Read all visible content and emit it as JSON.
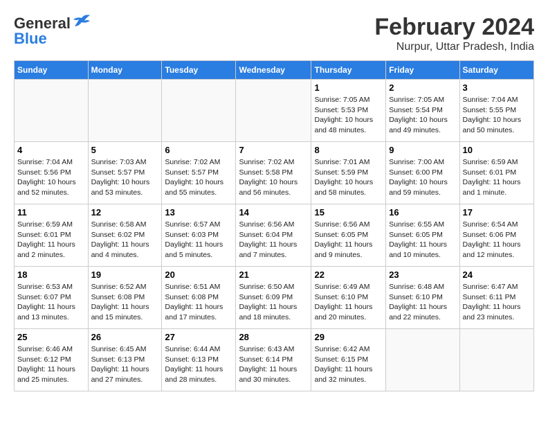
{
  "header": {
    "logo_general": "General",
    "logo_blue": "Blue",
    "month_year": "February 2024",
    "location": "Nurpur, Uttar Pradesh, India"
  },
  "days_of_week": [
    "Sunday",
    "Monday",
    "Tuesday",
    "Wednesday",
    "Thursday",
    "Friday",
    "Saturday"
  ],
  "weeks": [
    [
      {
        "day": "",
        "content": ""
      },
      {
        "day": "",
        "content": ""
      },
      {
        "day": "",
        "content": ""
      },
      {
        "day": "",
        "content": ""
      },
      {
        "day": "1",
        "content": "Sunrise: 7:05 AM\nSunset: 5:53 PM\nDaylight: 10 hours\nand 48 minutes."
      },
      {
        "day": "2",
        "content": "Sunrise: 7:05 AM\nSunset: 5:54 PM\nDaylight: 10 hours\nand 49 minutes."
      },
      {
        "day": "3",
        "content": "Sunrise: 7:04 AM\nSunset: 5:55 PM\nDaylight: 10 hours\nand 50 minutes."
      }
    ],
    [
      {
        "day": "4",
        "content": "Sunrise: 7:04 AM\nSunset: 5:56 PM\nDaylight: 10 hours\nand 52 minutes."
      },
      {
        "day": "5",
        "content": "Sunrise: 7:03 AM\nSunset: 5:57 PM\nDaylight: 10 hours\nand 53 minutes."
      },
      {
        "day": "6",
        "content": "Sunrise: 7:02 AM\nSunset: 5:57 PM\nDaylight: 10 hours\nand 55 minutes."
      },
      {
        "day": "7",
        "content": "Sunrise: 7:02 AM\nSunset: 5:58 PM\nDaylight: 10 hours\nand 56 minutes."
      },
      {
        "day": "8",
        "content": "Sunrise: 7:01 AM\nSunset: 5:59 PM\nDaylight: 10 hours\nand 58 minutes."
      },
      {
        "day": "9",
        "content": "Sunrise: 7:00 AM\nSunset: 6:00 PM\nDaylight: 10 hours\nand 59 minutes."
      },
      {
        "day": "10",
        "content": "Sunrise: 6:59 AM\nSunset: 6:01 PM\nDaylight: 11 hours\nand 1 minute."
      }
    ],
    [
      {
        "day": "11",
        "content": "Sunrise: 6:59 AM\nSunset: 6:01 PM\nDaylight: 11 hours\nand 2 minutes."
      },
      {
        "day": "12",
        "content": "Sunrise: 6:58 AM\nSunset: 6:02 PM\nDaylight: 11 hours\nand 4 minutes."
      },
      {
        "day": "13",
        "content": "Sunrise: 6:57 AM\nSunset: 6:03 PM\nDaylight: 11 hours\nand 5 minutes."
      },
      {
        "day": "14",
        "content": "Sunrise: 6:56 AM\nSunset: 6:04 PM\nDaylight: 11 hours\nand 7 minutes."
      },
      {
        "day": "15",
        "content": "Sunrise: 6:56 AM\nSunset: 6:05 PM\nDaylight: 11 hours\nand 9 minutes."
      },
      {
        "day": "16",
        "content": "Sunrise: 6:55 AM\nSunset: 6:05 PM\nDaylight: 11 hours\nand 10 minutes."
      },
      {
        "day": "17",
        "content": "Sunrise: 6:54 AM\nSunset: 6:06 PM\nDaylight: 11 hours\nand 12 minutes."
      }
    ],
    [
      {
        "day": "18",
        "content": "Sunrise: 6:53 AM\nSunset: 6:07 PM\nDaylight: 11 hours\nand 13 minutes."
      },
      {
        "day": "19",
        "content": "Sunrise: 6:52 AM\nSunset: 6:08 PM\nDaylight: 11 hours\nand 15 minutes."
      },
      {
        "day": "20",
        "content": "Sunrise: 6:51 AM\nSunset: 6:08 PM\nDaylight: 11 hours\nand 17 minutes."
      },
      {
        "day": "21",
        "content": "Sunrise: 6:50 AM\nSunset: 6:09 PM\nDaylight: 11 hours\nand 18 minutes."
      },
      {
        "day": "22",
        "content": "Sunrise: 6:49 AM\nSunset: 6:10 PM\nDaylight: 11 hours\nand 20 minutes."
      },
      {
        "day": "23",
        "content": "Sunrise: 6:48 AM\nSunset: 6:10 PM\nDaylight: 11 hours\nand 22 minutes."
      },
      {
        "day": "24",
        "content": "Sunrise: 6:47 AM\nSunset: 6:11 PM\nDaylight: 11 hours\nand 23 minutes."
      }
    ],
    [
      {
        "day": "25",
        "content": "Sunrise: 6:46 AM\nSunset: 6:12 PM\nDaylight: 11 hours\nand 25 minutes."
      },
      {
        "day": "26",
        "content": "Sunrise: 6:45 AM\nSunset: 6:13 PM\nDaylight: 11 hours\nand 27 minutes."
      },
      {
        "day": "27",
        "content": "Sunrise: 6:44 AM\nSunset: 6:13 PM\nDaylight: 11 hours\nand 28 minutes."
      },
      {
        "day": "28",
        "content": "Sunrise: 6:43 AM\nSunset: 6:14 PM\nDaylight: 11 hours\nand 30 minutes."
      },
      {
        "day": "29",
        "content": "Sunrise: 6:42 AM\nSunset: 6:15 PM\nDaylight: 11 hours\nand 32 minutes."
      },
      {
        "day": "",
        "content": ""
      },
      {
        "day": "",
        "content": ""
      }
    ]
  ]
}
